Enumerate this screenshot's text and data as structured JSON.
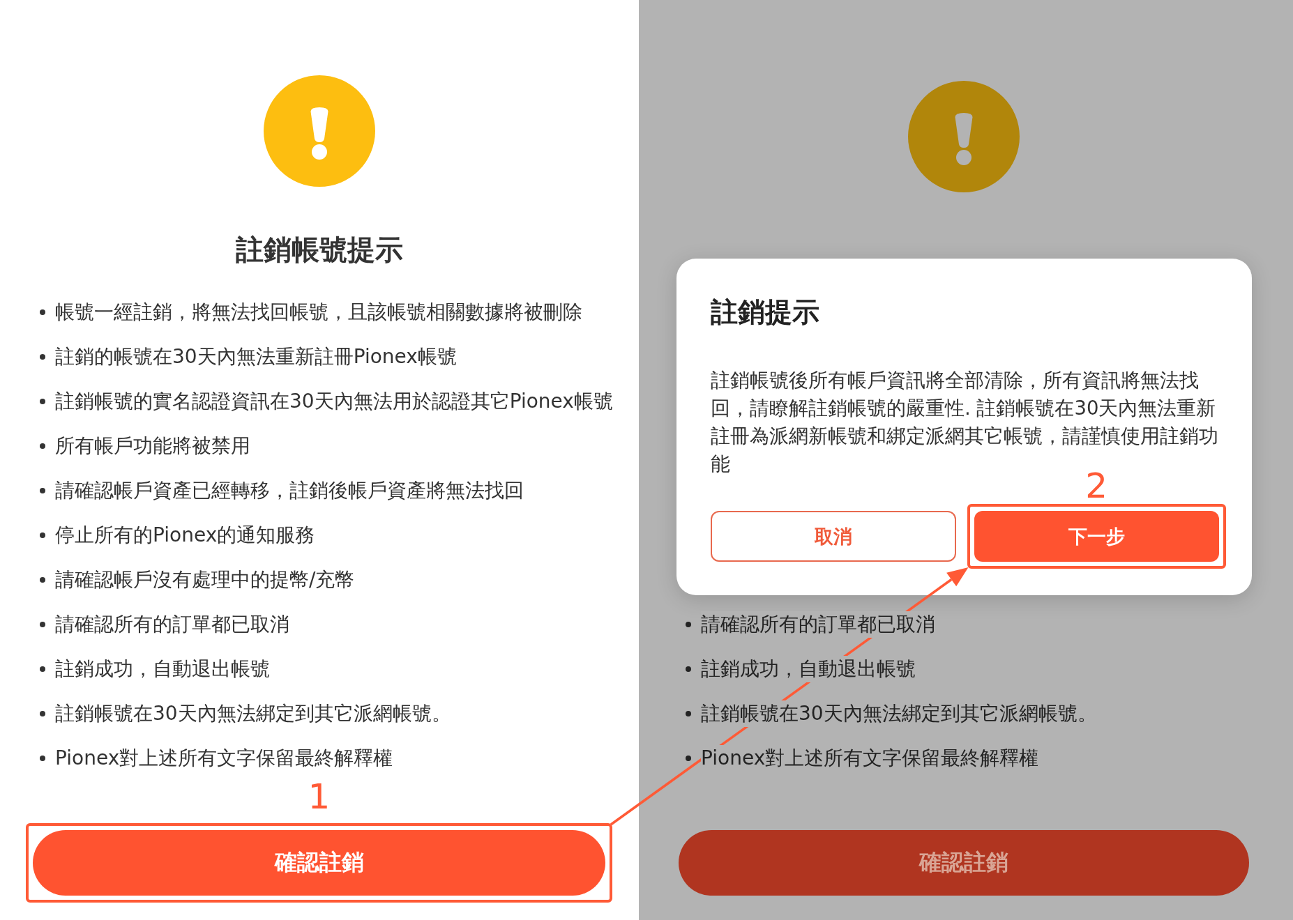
{
  "screens": [
    {
      "dimmed": false,
      "title": "註銷帳號提示",
      "notes": [
        "帳號一經註銷，將無法找回帳號，且該帳號相關數據將被刪除",
        "註銷的帳號在30天內無法重新註冊Pionex帳號",
        "註銷帳號的實名認證資訊在30天內無法用於認證其它Pionex帳號",
        "所有帳戶功能將被禁用",
        "請確認帳戶資產已經轉移，註銷後帳戶資產將無法找回",
        "停止所有的Pionex的通知服務",
        "請確認帳戶沒有處理中的提幣/充幣",
        "請確認所有的訂單都已取消",
        "註銷成功，自動退出帳號",
        "註銷帳號在30天內無法綁定到其它派網帳號。",
        "Pionex對上述所有文字保留最終解釋權"
      ],
      "confirm_button": {
        "label": "確認註銷",
        "marker": "1"
      }
    },
    {
      "dimmed": true,
      "notes": [
        "請確認所有的訂單都已取消",
        "註銷成功，自動退出帳號",
        "註銷帳號在30天內無法綁定到其它派網帳號。",
        "Pionex對上述所有文字保留最終解釋權"
      ],
      "confirm_button": {
        "label": "確認註銷"
      },
      "dialog": {
        "title": "註銷提示",
        "message": "註銷帳號後所有帳戶資訊將全部清除，所有資訊將無法找回，請瞭解註銷帳號的嚴重性. 註銷帳號在30天內無法重新註冊為派網新帳號和綁定派網其它帳號，請謹慎使用註銷功能",
        "buttons": [
          {
            "kind": "outline",
            "label": "取消"
          },
          {
            "kind": "filled",
            "label": "下一步",
            "marker": "2"
          }
        ]
      }
    }
  ]
}
